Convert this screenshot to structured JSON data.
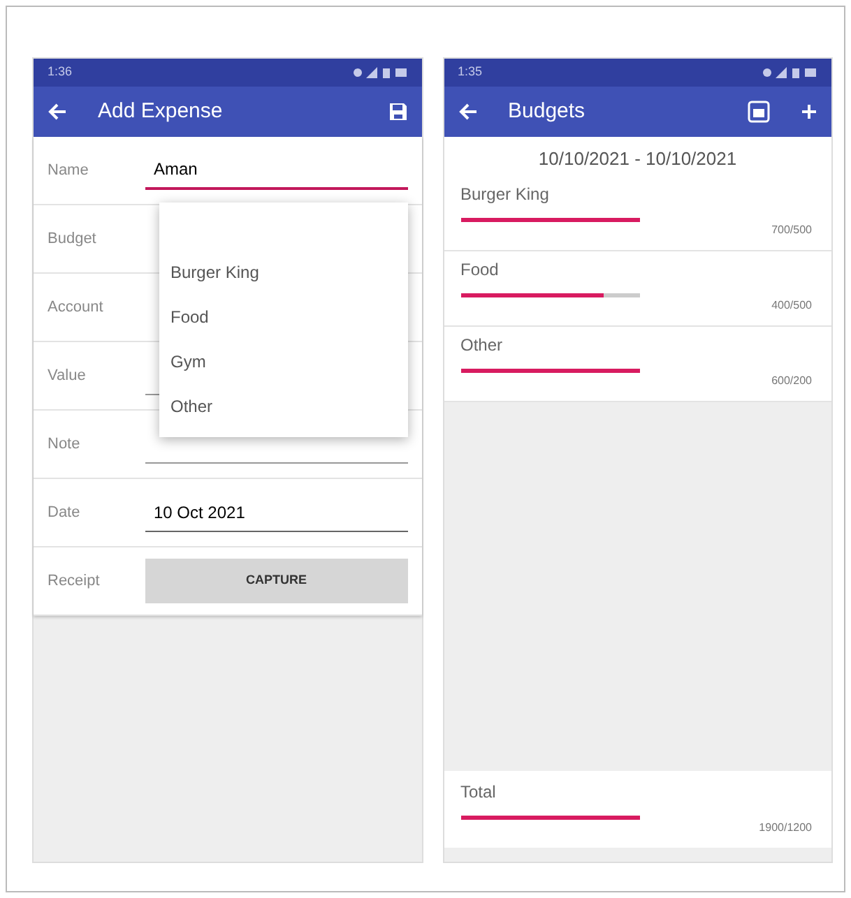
{
  "add_expense": {
    "status_time": "1:36",
    "title": "Add Expense",
    "fields": [
      {
        "label": "Name",
        "kind": "input",
        "value": "Aman",
        "focused": true
      },
      {
        "label": "Budget",
        "kind": "select"
      },
      {
        "label": "Account",
        "kind": "select"
      },
      {
        "label": "Value",
        "kind": "input",
        "focused": false
      },
      {
        "label": "Note",
        "kind": "input",
        "focused": false
      },
      {
        "label": "Date",
        "kind": "date",
        "value": "10 Oct 2021",
        "focused": false
      },
      {
        "label": "Receipt",
        "kind": "button",
        "value": "CAPTURE"
      }
    ],
    "dropdown": {
      "options": [
        "Burger King",
        "Food",
        "Gym",
        "Other"
      ]
    }
  },
  "budgets": {
    "status_time": "1:35",
    "title": "Budgets",
    "date_range": "10/10/2021 - 10/10/2021",
    "items": [
      {
        "name": "Burger King",
        "level": 1,
        "reading": "700/500"
      },
      {
        "name": "Food",
        "level": 0.8,
        "reading": "400/500"
      },
      {
        "name": "Other",
        "level": 1,
        "reading": "600/200"
      }
    ],
    "total": {
      "name": "Total",
      "level": 1,
      "reading": "1900/1200"
    }
  }
}
